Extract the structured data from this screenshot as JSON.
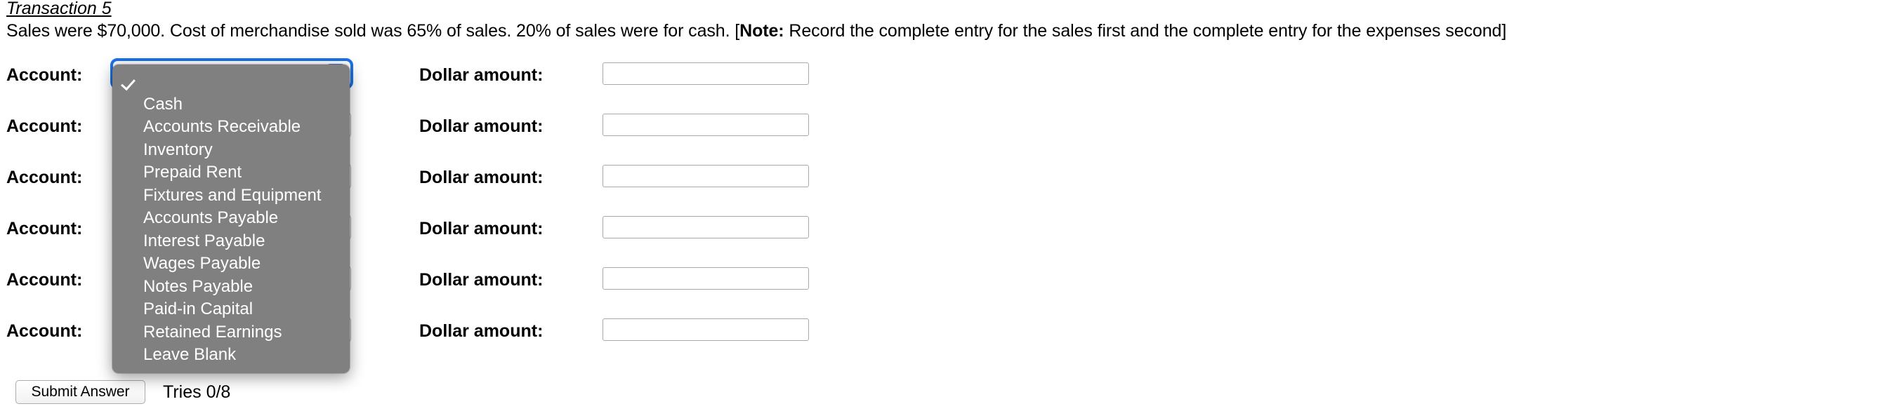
{
  "heading": {
    "transaction_title": "Transaction 5",
    "prompt_part1": "Sales were $70,000. Cost of merchandise sold was 65% of sales. 20% of sales were for cash. [",
    "prompt_note_label": "Note:",
    "prompt_part2": " Record the complete entry for the sales first and the complete entry for the expenses second]"
  },
  "labels": {
    "account": "Account:",
    "dollar_amount": "Dollar amount:"
  },
  "rows": [
    {
      "account_value": "",
      "amount_value": "",
      "amount_placeholder": ""
    },
    {
      "account_value": "",
      "amount_value": "",
      "amount_placeholder": ""
    },
    {
      "account_value": "",
      "amount_value": "",
      "amount_placeholder": ""
    },
    {
      "account_value": "",
      "amount_value": "",
      "amount_placeholder": ""
    },
    {
      "account_value": "",
      "amount_value": "",
      "amount_placeholder": ""
    },
    {
      "account_value": "",
      "amount_value": "",
      "amount_placeholder": ""
    }
  ],
  "dropdown": {
    "open": true,
    "selected_index": 0,
    "options": [
      "",
      "Cash",
      "Accounts Receivable",
      "Inventory",
      "Prepaid Rent",
      "Fixtures and Equipment",
      "Accounts Payable",
      "Interest Payable",
      "Wages Payable",
      "Notes Payable",
      "Paid-in Capital",
      "Retained Earnings",
      "Leave Blank"
    ],
    "background_color": "#808080",
    "text_color": "#ffffff"
  },
  "footer": {
    "submit_label": "Submit Answer",
    "tries_label": "Tries 0/8"
  },
  "accent_color": "#1a73e8"
}
